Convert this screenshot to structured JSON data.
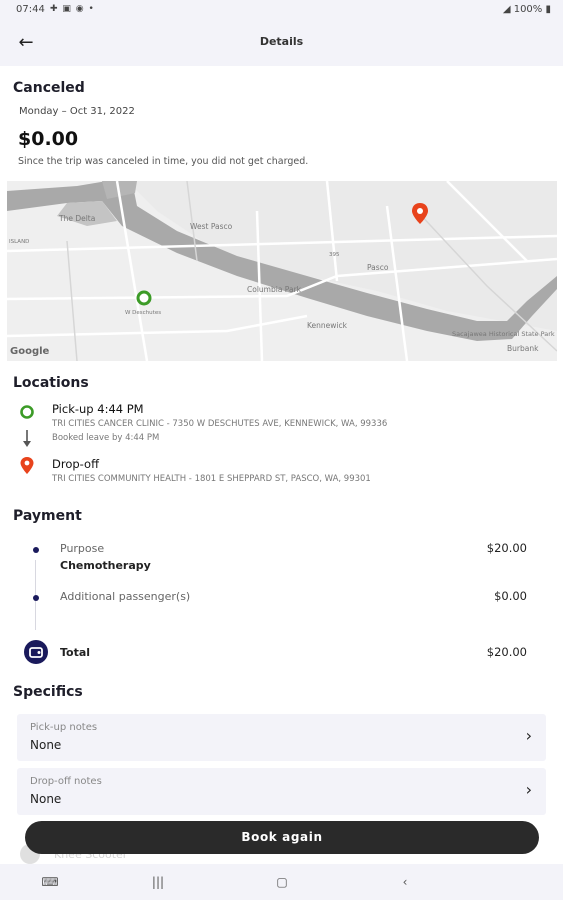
{
  "status_bar": {
    "time": "07:44",
    "notifications": "✚ ▣ ◉ •",
    "battery": "100%"
  },
  "header": {
    "title": "Details"
  },
  "trip": {
    "status": "Canceled",
    "date": "Monday – Oct 31, 2022",
    "amount": "$0.00",
    "note": "Since the trip was canceled in time, you did not get charged."
  },
  "map": {
    "attribution": "Google",
    "labels": {
      "the_delta": "The Delta",
      "west_pasco": "West Pasco",
      "pasco": "Pasco",
      "columbia_park": "Columbia Park",
      "kennewick": "Kennewick",
      "deschutes": "W Deschutes",
      "burbank": "Burbank",
      "sacajawea": "Sacajawea Historical State Park",
      "island": "ISLAND",
      "road_395": "395"
    }
  },
  "locations": {
    "heading": "Locations",
    "pickup": {
      "title": "Pick-up 4:44 PM",
      "address": "TRI CITIES CANCER CLINIC - 7350 W DESCHUTES AVE, KENNEWICK, WA, 99336",
      "booked": "Booked leave by 4:44 PM"
    },
    "dropoff": {
      "title": "Drop-off",
      "address": "TRI CITIES COMMUNITY HEALTH - 1801 E SHEPPARD ST, PASCO, WA, 99301"
    }
  },
  "payment": {
    "heading": "Payment",
    "items": [
      {
        "label": "Purpose",
        "sub": "Chemotherapy",
        "value": "$20.00"
      },
      {
        "label": "Additional passenger(s)",
        "sub": "",
        "value": "$0.00"
      }
    ],
    "total_label": "Total",
    "total_value": "$20.00"
  },
  "specifics": {
    "heading": "Specifics",
    "pickup_notes": {
      "label": "Pick-up notes",
      "value": "None"
    },
    "dropoff_notes": {
      "label": "Drop-off notes",
      "value": "None"
    },
    "ghost_item": "Knee Scooter"
  },
  "actions": {
    "book_again": "Book again"
  },
  "colors": {
    "pickup_green": "#3c9b27",
    "dropoff_red": "#e8431c",
    "navy": "#1a1a5c",
    "button_dark": "#2a2a2a",
    "header_bg": "#f3f3f9"
  },
  "icons": {
    "back": "arrow-left-icon",
    "pickup": "green-circle-pin-icon",
    "dropoff": "red-map-pin-icon",
    "chevron": "chevron-right-icon",
    "total": "wallet-icon"
  }
}
